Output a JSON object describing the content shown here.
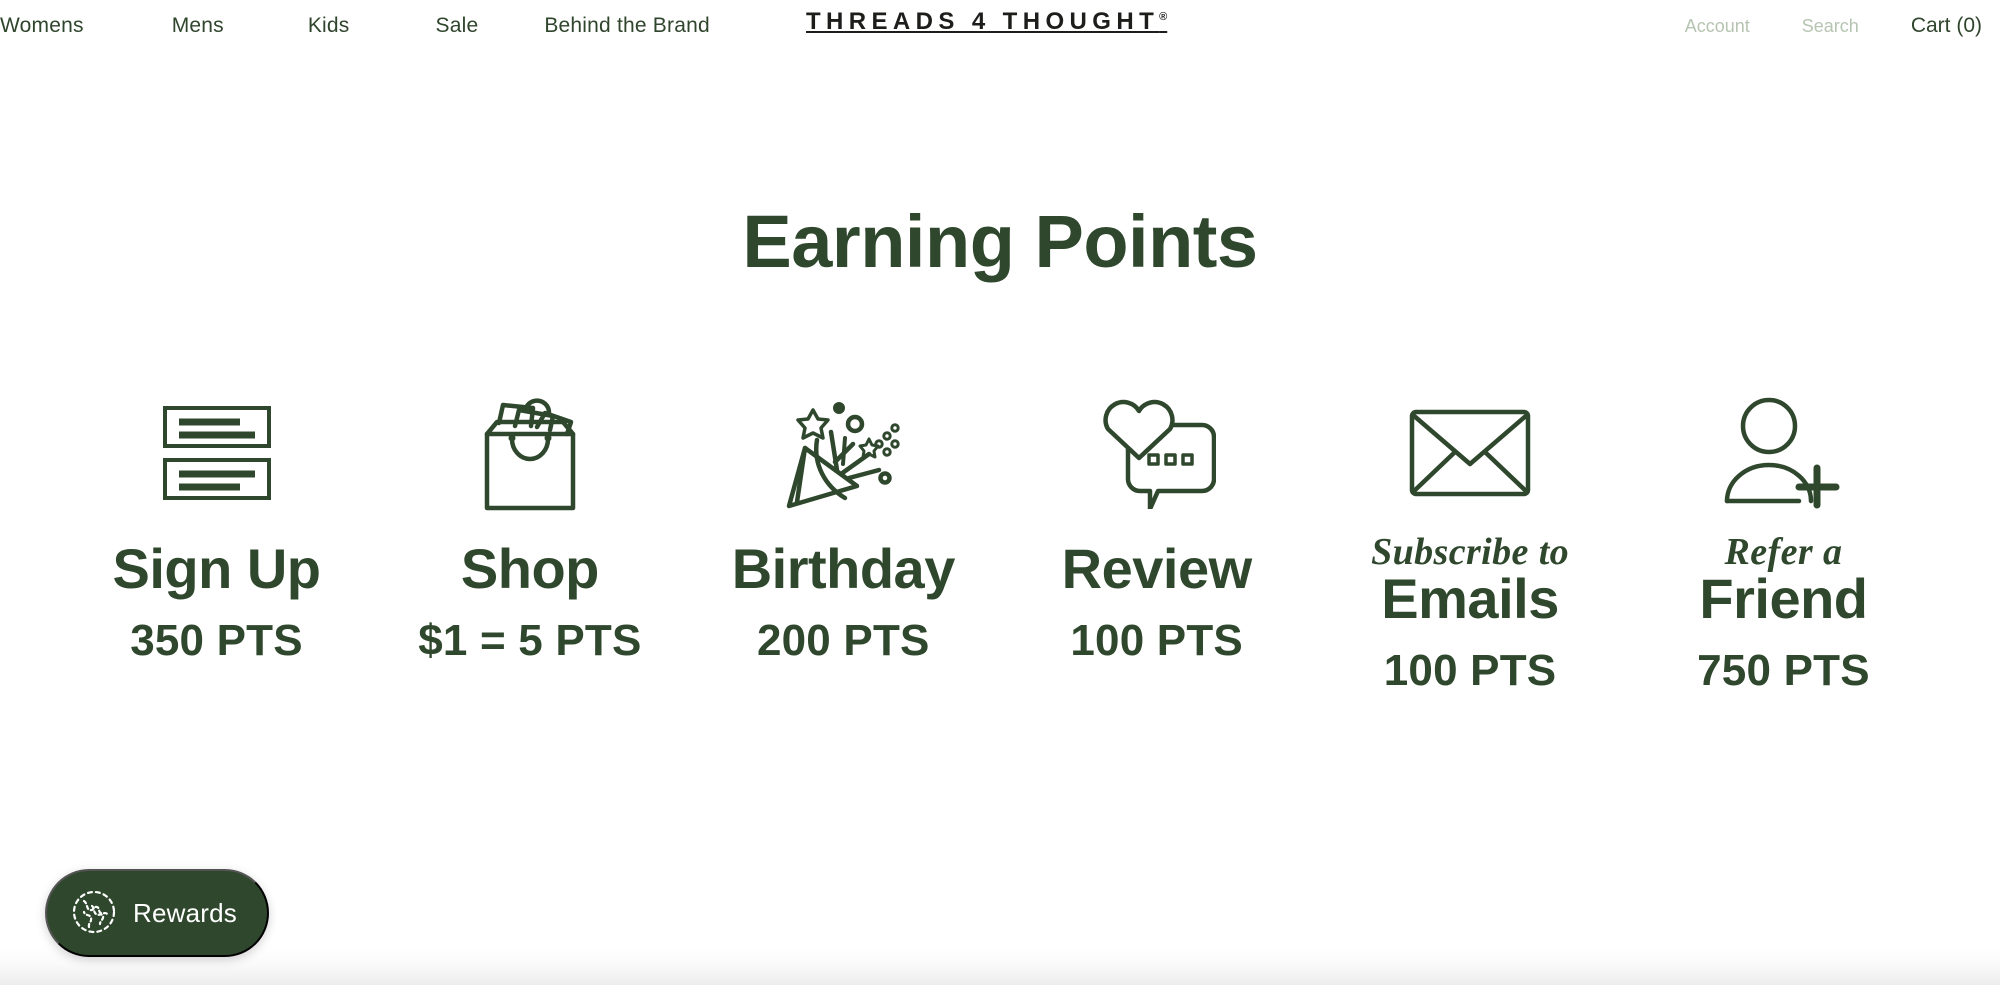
{
  "header": {
    "nav": [
      {
        "label": "Womens",
        "name": "nav-womens"
      },
      {
        "label": "Mens",
        "name": "nav-mens"
      },
      {
        "label": "Kids",
        "name": "nav-kids"
      },
      {
        "label": "Sale",
        "name": "nav-sale"
      },
      {
        "label": "Behind the Brand",
        "name": "nav-behind-the-brand"
      }
    ],
    "brand": "THREADS 4 THOUGHT",
    "brand_registered": "®",
    "account_label": "Account",
    "search_label": "Search",
    "cart_label": "Cart (0)",
    "cart_count": 0
  },
  "main": {
    "title": "Earning Points",
    "cards": [
      {
        "icon": "form-signup-icon",
        "script": "",
        "label": "Sign Up",
        "points": "350 PTS"
      },
      {
        "icon": "shopping-bag-icon",
        "script": "",
        "label": "Shop",
        "points": "$1 = 5 PTS"
      },
      {
        "icon": "party-popper-icon",
        "script": "",
        "label": "Birthday",
        "points": "200 PTS"
      },
      {
        "icon": "heart-speech-bubble-icon",
        "script": "",
        "label": "Review",
        "points": "100 PTS"
      },
      {
        "icon": "envelope-icon",
        "script": "Subscribe to",
        "label": "Emails",
        "points": "100 PTS"
      },
      {
        "icon": "person-add-icon",
        "script": "Refer a",
        "label": "Friend",
        "points": "750 PTS"
      }
    ]
  },
  "rewards_widget": {
    "label": "Rewards",
    "icon": "globe-icon"
  },
  "colors": {
    "brand_green": "#2f482d",
    "nav_green": "#2f452c",
    "muted_green": "#b6c4b2",
    "logo_black": "#1d1d1b",
    "page_background": "#ffffff",
    "widget_background": "#2f482d",
    "widget_text": "#ffffff"
  }
}
